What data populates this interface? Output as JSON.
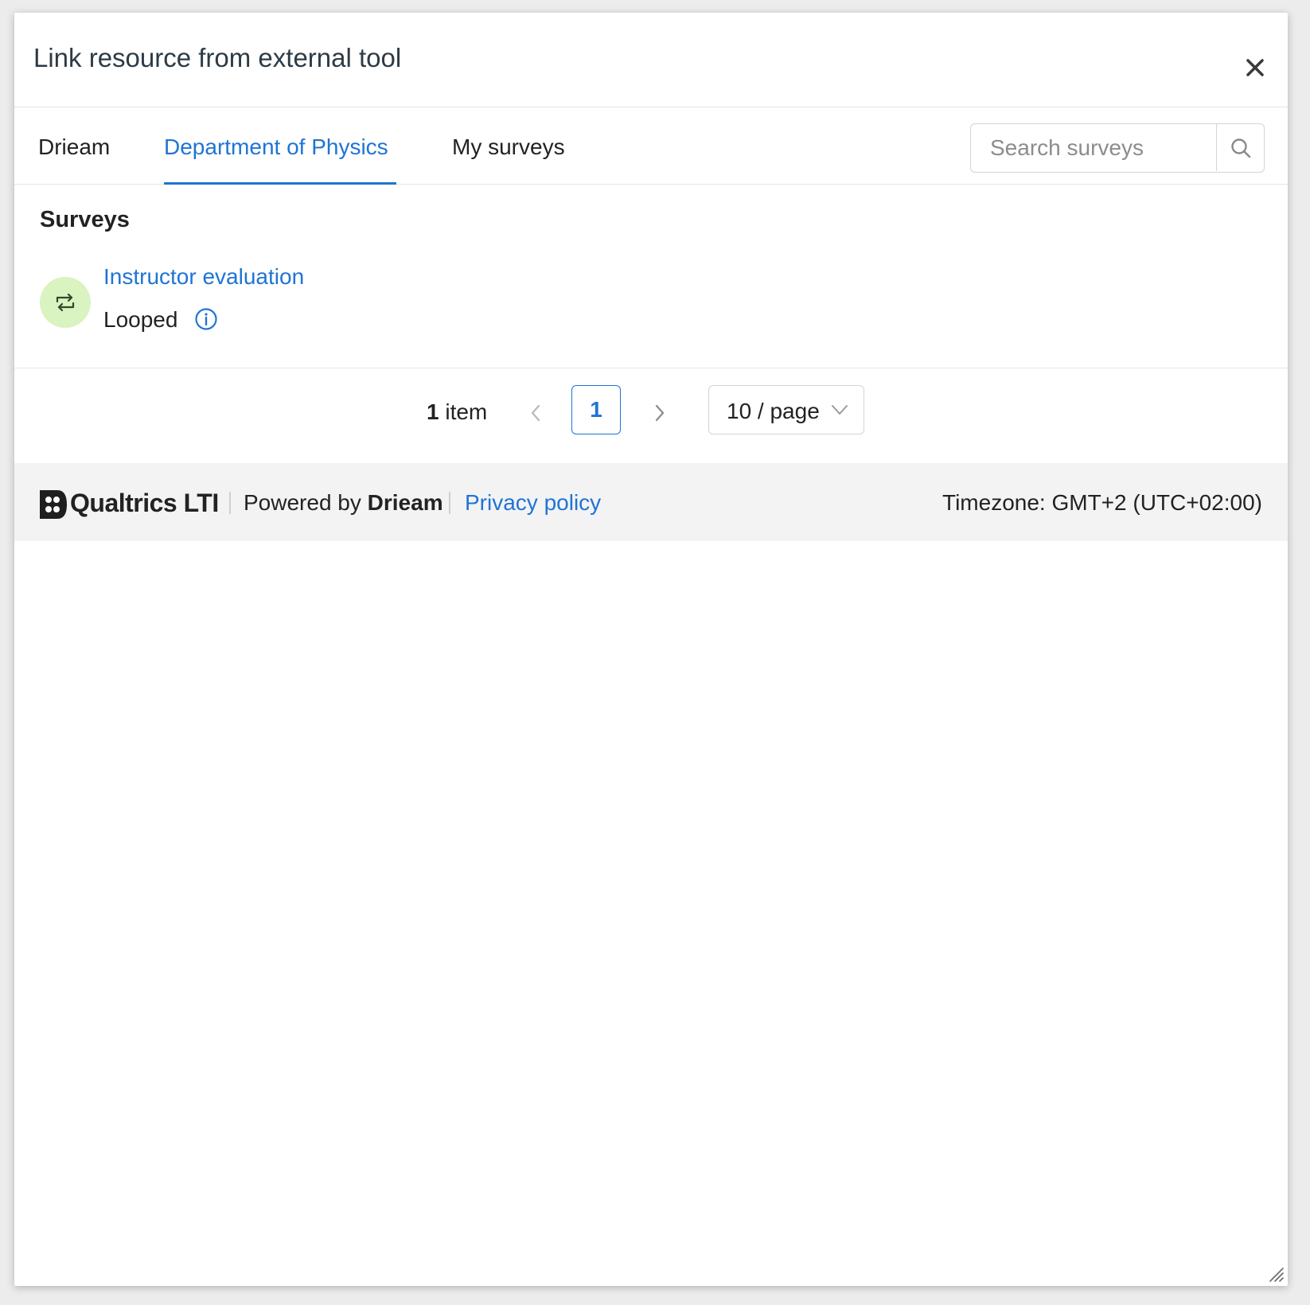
{
  "dialog": {
    "title": "Link resource from external tool",
    "close_icon": "close-icon"
  },
  "tabs": [
    {
      "label": "Drieam",
      "active": false
    },
    {
      "label": "Department of Physics",
      "active": true
    },
    {
      "label": "My surveys",
      "active": false
    }
  ],
  "search": {
    "placeholder": "Search surveys",
    "value": "",
    "icon": "search-icon"
  },
  "section": {
    "title": "Surveys"
  },
  "surveys": [
    {
      "name": "Instructor evaluation",
      "status": "Looped",
      "icon": "loop-icon",
      "status_icon": "info-icon"
    }
  ],
  "pagination": {
    "total_count": "1",
    "total_suffix": "item",
    "current_page": "1",
    "page_size_label": "10 / page"
  },
  "footer": {
    "brand": "Qualtrics LTI",
    "powered_prefix": "Powered by",
    "powered_by": "Drieam",
    "privacy_link": "Privacy policy",
    "timezone": "Timezone: GMT+2 (UTC+02:00)"
  },
  "colors": {
    "accent": "#1f74d4",
    "avatar_bg": "#d9f3c1",
    "footer_bg": "#f3f3f4"
  }
}
